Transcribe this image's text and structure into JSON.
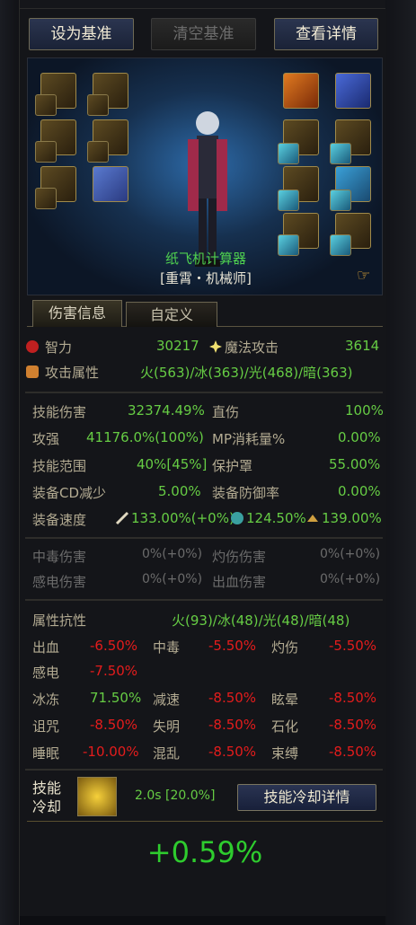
{
  "header": {
    "set_baseline": "设为基准",
    "clear_baseline": "清空基准",
    "view_details": "查看详情"
  },
  "character": {
    "name": "纸飞机计算器",
    "class": "[重霄・机械师]"
  },
  "tabs": [
    "伤害信息",
    "自定义"
  ],
  "attributes": {
    "int_label": "智力",
    "int_value": "30217",
    "matk_label": "魔法攻击",
    "matk_value": "3614",
    "elem_label": "攻击属性",
    "elem_value": "火(563)/冰(363)/光(468)/暗(363)"
  },
  "damage": {
    "skill_dmg_label": "技能伤害",
    "skill_dmg_value": "32374.49%",
    "direct_label": "直伤",
    "direct_value": "100%",
    "atk_label": "攻强",
    "atk_value": "41176.0%(100%)",
    "mp_label": "MP消耗量%",
    "mp_value": "0.00%",
    "range_label": "技能范围",
    "range_value": "40%[45%]",
    "shield_label": "保护罩",
    "shield_value": "55.00%",
    "cd_label": "装备CD减少",
    "cd_value": "5.00%",
    "def_label": "装备防御率",
    "def_value": "0.00%",
    "speed_label": "装备速度",
    "speed1": "133.00%(+0%)",
    "speed2": "124.50%",
    "speed3": "139.00%"
  },
  "dot": {
    "poison_label": "中毒伤害",
    "poison_value": "0%(+0%)",
    "burn_label": "灼伤伤害",
    "burn_value": "0%(+0%)",
    "shock_label": "感电伤害",
    "shock_value": "0%(+0%)",
    "bleed_label": "出血伤害",
    "bleed_value": "0%(+0%)"
  },
  "resist": {
    "label": "属性抗性",
    "value": "火(93)/冰(48)/光(48)/暗(48)",
    "bleed_l": "出血",
    "bleed_v": "-6.50%",
    "poison_l": "中毒",
    "poison_v": "-5.50%",
    "burn_l": "灼伤",
    "burn_v": "-5.50%",
    "shock_l": "感电",
    "shock_v": "-7.50%",
    "freeze_l": "冰冻",
    "freeze_v": "71.50%",
    "slow_l": "减速",
    "slow_v": "-8.50%",
    "stun_l": "眩晕",
    "stun_v": "-8.50%",
    "curse_l": "诅咒",
    "curse_v": "-8.50%",
    "blind_l": "失明",
    "blind_v": "-8.50%",
    "stone_l": "石化",
    "stone_v": "-8.50%",
    "sleep_l": "睡眠",
    "sleep_v": "-10.00%",
    "chaos_l": "混乱",
    "chaos_v": "-8.50%",
    "bind_l": "束缚",
    "bind_v": "-8.50%"
  },
  "cooldown": {
    "label1": "技能",
    "label2": "冷却",
    "value": "2.0s [20.0%]",
    "details_button": "技能冷却详情"
  },
  "result": "+0.59%"
}
